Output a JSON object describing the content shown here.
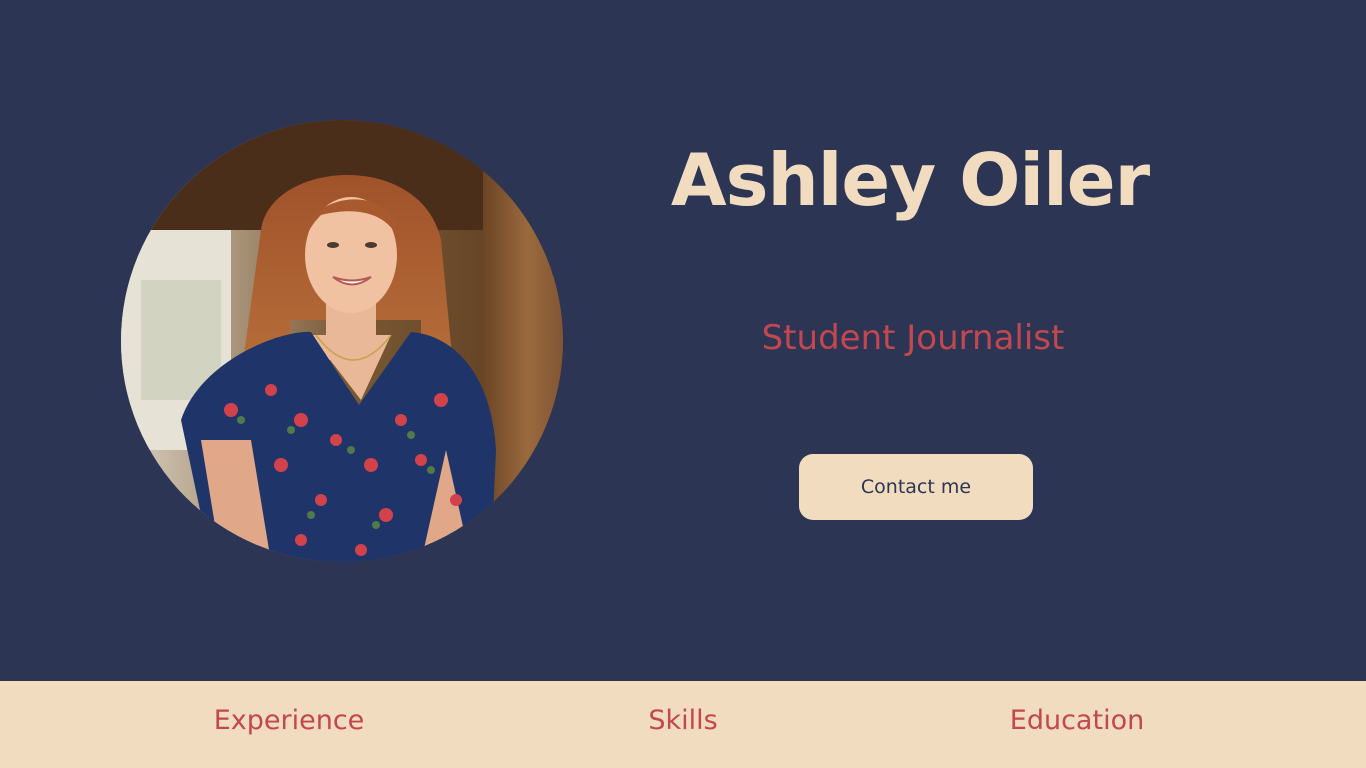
{
  "profile": {
    "name": "Ashley Oiler",
    "role": "Student Journalist",
    "contact_label": "Contact me"
  },
  "nav": {
    "items": [
      {
        "label": "Experience"
      },
      {
        "label": "Skills"
      },
      {
        "label": "Education"
      }
    ]
  },
  "colors": {
    "background": "#2c3554",
    "accent_cream": "#f1dcc0",
    "accent_red": "#c2474f"
  }
}
